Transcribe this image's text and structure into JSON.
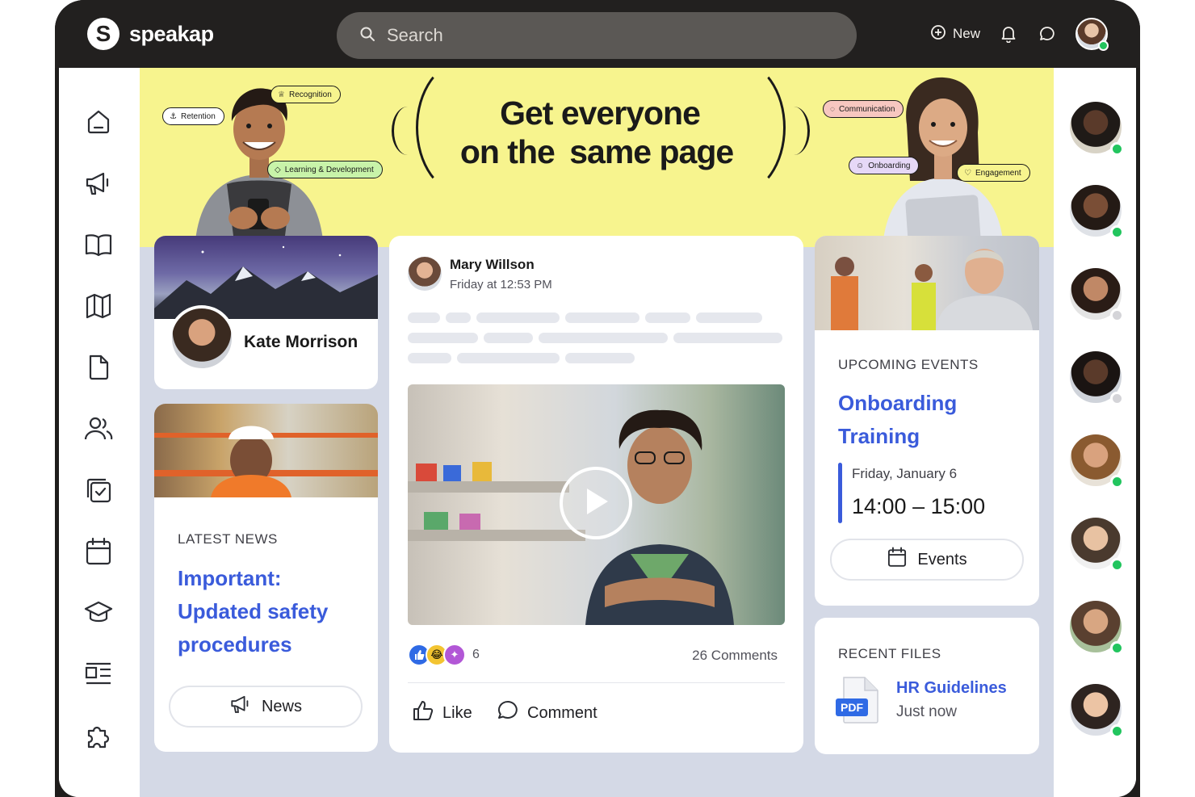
{
  "brand": {
    "logo_letter": "S",
    "name": "speakap"
  },
  "search": {
    "placeholder": "Search"
  },
  "topbar": {
    "new_label": "New"
  },
  "nav": {
    "items": [
      "home-icon",
      "megaphone-icon",
      "book-icon",
      "map-icon",
      "file-icon",
      "users-icon",
      "tasks-icon",
      "calendar-icon",
      "graduation-cap-icon",
      "layout-list-icon",
      "puzzle-icon"
    ]
  },
  "banner": {
    "headline_line1": "Get everyone",
    "headline_line2_prefix": "on the",
    "headline_line2_highlight": "same page",
    "tags": {
      "retention": "Retention",
      "recognition": "Recognition",
      "learning": "Learning & Development",
      "communication": "Communication",
      "onboarding": "Onboarding",
      "engagement": "Engagement"
    }
  },
  "profile_card": {
    "name": "Kate Morrison"
  },
  "news_card": {
    "eyebrow": "LATEST NEWS",
    "title_line1": "Important:",
    "title_line2": "Updated safety",
    "title_line3": "procedures",
    "button_label": "News"
  },
  "post": {
    "author": "Mary Willson",
    "timestamp": "Friday at 12:53 PM",
    "reaction_count": "6",
    "comments": "26 Comments",
    "like_label": "Like",
    "comment_label": "Comment"
  },
  "events_card": {
    "eyebrow": "UPCOMING EVENTS",
    "title_line1": "Onboarding",
    "title_line2": "Training",
    "date": "Friday, January 6",
    "time": "14:00 – 15:00",
    "button_label": "Events"
  },
  "files_card": {
    "eyebrow": "RECENT FILES",
    "file_type": "PDF",
    "file_name": "HR Guidelines",
    "file_time": "Just now"
  },
  "colors": {
    "accent": "#3a5bdb",
    "banner": "#f7f48e",
    "highlight": "#f1b6de",
    "online": "#22c55e",
    "backdrop": "#d4d9e6"
  },
  "rail": {
    "statuses": [
      "online",
      "online",
      "offline",
      "offline",
      "online",
      "online",
      "online",
      "online"
    ]
  }
}
